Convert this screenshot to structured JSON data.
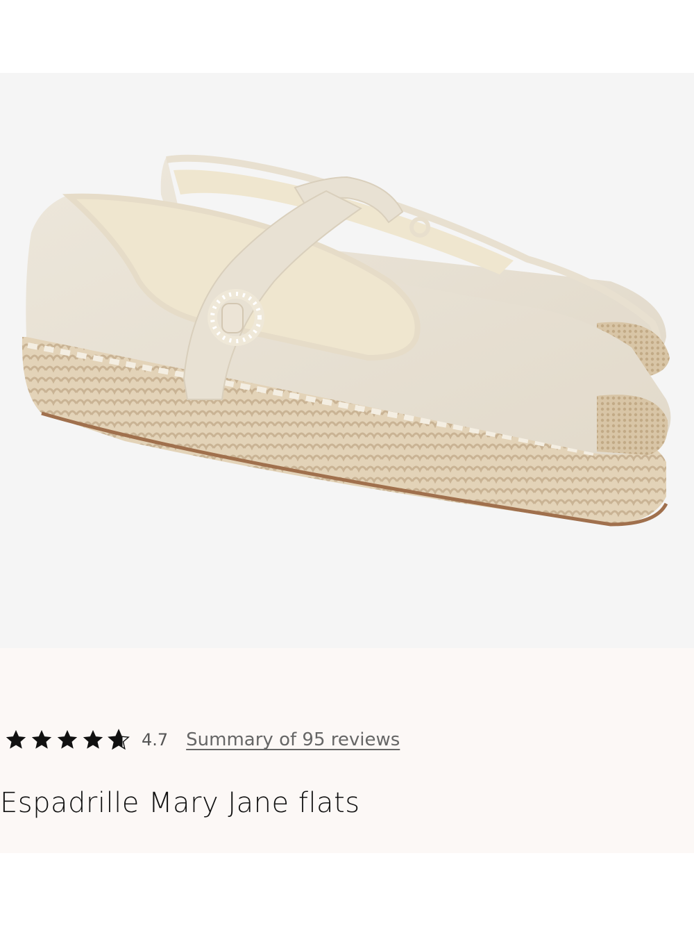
{
  "product": {
    "image_alt": "Espadrille Mary Jane flats",
    "rating": {
      "stars_filled": 4.7,
      "stars_total": 5,
      "value": "4.7",
      "reviews_link": "Summary of 95 reviews"
    },
    "title": "Espadrille Mary Jane flats"
  },
  "colors": {
    "image_background": "#f5f5f5",
    "info_background": "#fcf8f6",
    "text": "#111111",
    "muted_text": "#666666"
  }
}
